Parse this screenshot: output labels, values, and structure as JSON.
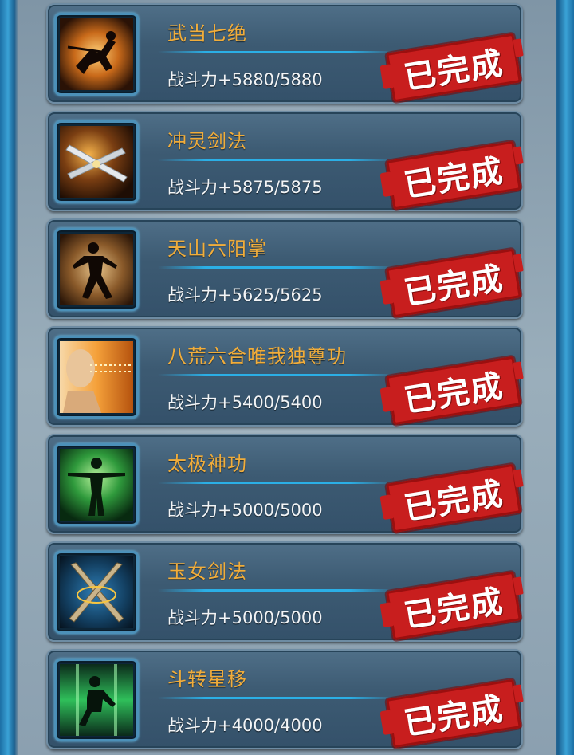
{
  "stamp_label": "已完成",
  "colors": {
    "title": "#f1ad3b",
    "power_text": "#f2f4f6",
    "stamp": "#c81e1e",
    "divider": "#2bafe6"
  },
  "skills": [
    {
      "title": "武当七绝",
      "power": "战斗力+5880/5880",
      "icon": "leaping-warrior-icon"
    },
    {
      "title": "冲灵剑法",
      "power": "战斗力+5875/5875",
      "icon": "crossed-swords-icon"
    },
    {
      "title": "天山六阳掌",
      "power": "战斗力+5625/5625",
      "icon": "martial-stance-icon"
    },
    {
      "title": "八荒六合唯我独尊功",
      "power": "战斗力+5400/5400",
      "icon": "bald-master-icon"
    },
    {
      "title": "太极神功",
      "power": "战斗力+5000/5000",
      "icon": "tai-chi-figure-icon"
    },
    {
      "title": "玉女剑法",
      "power": "战斗力+5000/5000",
      "icon": "twin-swords-icon"
    },
    {
      "title": "斗转星移",
      "power": "战斗力+4000/4000",
      "icon": "kicking-fighter-icon"
    }
  ]
}
